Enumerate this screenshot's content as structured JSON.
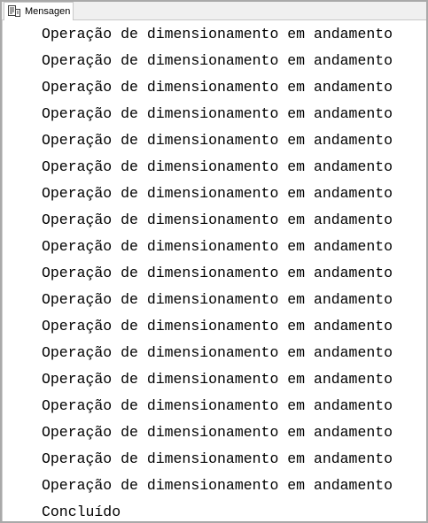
{
  "tab": {
    "label": "Mensagen",
    "icon": "messages-document-icon"
  },
  "messages": [
    "Operação de dimensionamento em andamento",
    "Operação de dimensionamento em andamento",
    "Operação de dimensionamento em andamento",
    "Operação de dimensionamento em andamento",
    "Operação de dimensionamento em andamento",
    "Operação de dimensionamento em andamento",
    "Operação de dimensionamento em andamento",
    "Operação de dimensionamento em andamento",
    "Operação de dimensionamento em andamento",
    "Operação de dimensionamento em andamento",
    "Operação de dimensionamento em andamento",
    "Operação de dimensionamento em andamento",
    "Operação de dimensionamento em andamento",
    "Operação de dimensionamento em andamento",
    "Operação de dimensionamento em andamento",
    "Operação de dimensionamento em andamento",
    "Operação de dimensionamento em andamento",
    "Operação de dimensionamento em andamento",
    "Concluído"
  ]
}
